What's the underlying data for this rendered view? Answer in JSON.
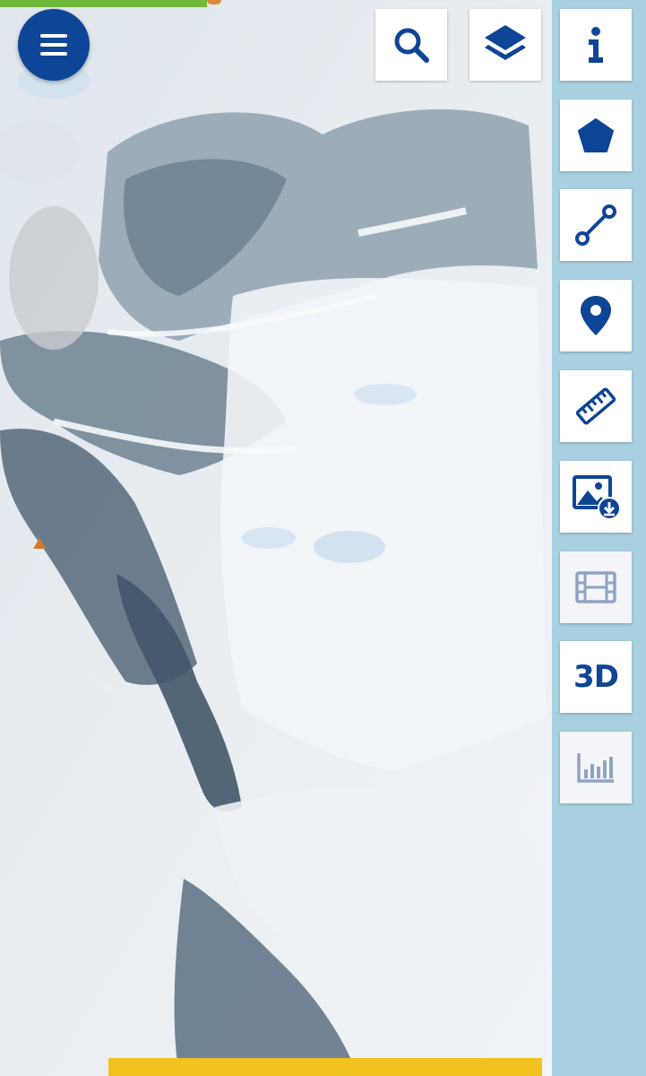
{
  "colors": {
    "brand_blue": "#0e4596",
    "disabled_icon": "#8fa3c4",
    "sidebar_bg": "#a8d0e0",
    "progress_green": "#6fb83a",
    "bottom_bar_yellow": "#f2c21f"
  },
  "progress": {
    "fraction": 0.32
  },
  "header": {
    "menu_button": {
      "icon": "hamburger-menu-icon"
    },
    "search_button": {
      "icon": "search-icon"
    },
    "layers_button": {
      "icon": "layers-icon"
    }
  },
  "toolbar": {
    "info_button": {
      "icon": "info-icon"
    },
    "polygon_button": {
      "icon": "pentagon-icon"
    },
    "line_button": {
      "icon": "line-segment-icon"
    },
    "point_button": {
      "icon": "map-pin-icon"
    },
    "measure_button": {
      "icon": "ruler-icon"
    },
    "image_download_button": {
      "icon": "image-download-icon"
    },
    "timelapse_button": {
      "icon": "film-icon",
      "enabled": false
    },
    "three_d_button": {
      "label": "3D"
    },
    "statistics_button": {
      "icon": "bar-chart-icon",
      "enabled": false
    }
  }
}
